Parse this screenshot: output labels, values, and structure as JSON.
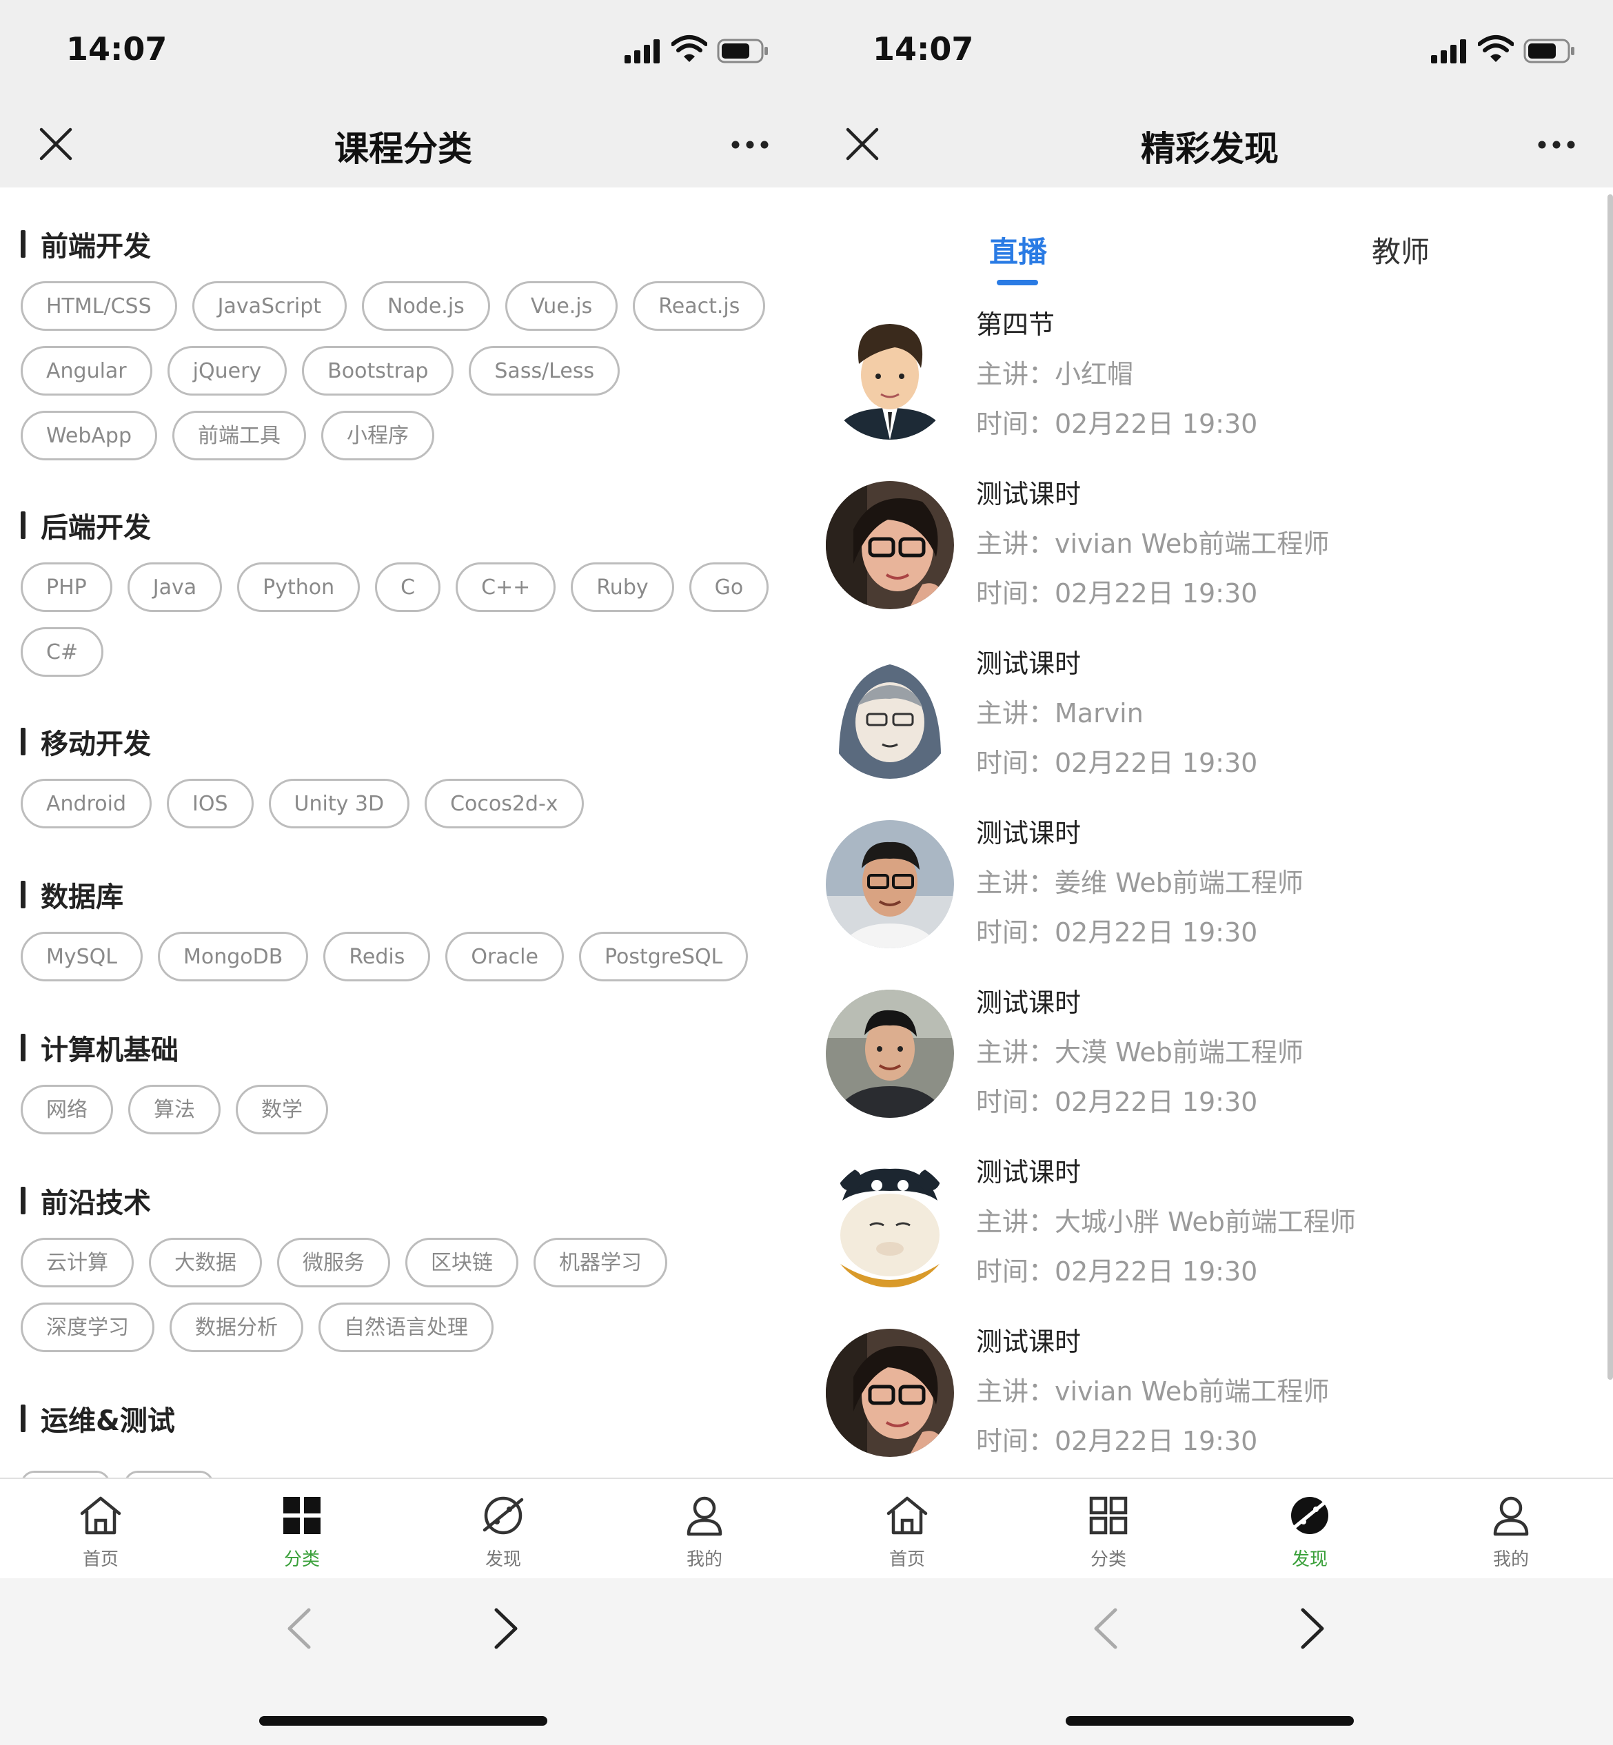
{
  "status": {
    "time": "14:07"
  },
  "left": {
    "title": "课程分类",
    "sections": [
      {
        "title": "前端开发",
        "tags": [
          "HTML/CSS",
          "JavaScript",
          "Node.js",
          "Vue.js",
          "React.js",
          "Angular",
          "jQuery",
          "Bootstrap",
          "Sass/Less",
          "WebApp",
          "前端工具",
          "小程序"
        ]
      },
      {
        "title": "后端开发",
        "tags": [
          "PHP",
          "Java",
          "Python",
          "C",
          "C++",
          "Ruby",
          "Go",
          "C#"
        ]
      },
      {
        "title": "移动开发",
        "tags": [
          "Android",
          "IOS",
          "Unity 3D",
          "Cocos2d-x"
        ]
      },
      {
        "title": "数据库",
        "tags": [
          "MySQL",
          "MongoDB",
          "Redis",
          "Oracle",
          "PostgreSQL"
        ]
      },
      {
        "title": "计算机基础",
        "tags": [
          "网络",
          "算法",
          "数学"
        ]
      },
      {
        "title": "前沿技术",
        "tags": [
          "云计算",
          "大数据",
          "微服务",
          "区块链",
          "机器学习",
          "深度学习",
          "数据分析",
          "自然语言处理"
        ]
      },
      {
        "title": "运维&测试",
        "tags": []
      }
    ]
  },
  "right": {
    "title": "精彩发现",
    "tabs": {
      "live": "直播",
      "teacher": "教师"
    },
    "items": [
      {
        "title": "第四节",
        "host": "主讲：小红帽",
        "time": "时间：02月22日 19:30",
        "avatar": "cartoon-man"
      },
      {
        "title": "测试课时",
        "host": "主讲：vivian  Web前端工程师",
        "time": "时间：02月22日 19:30",
        "avatar": "woman-glasses"
      },
      {
        "title": "测试课时",
        "host": "主讲：Marvin",
        "time": "时间：02月22日 19:30",
        "avatar": "hooded-cartoon"
      },
      {
        "title": "测试课时",
        "host": "主讲：姜维  Web前端工程师",
        "time": "时间：02月22日 19:30",
        "avatar": "man-glasses"
      },
      {
        "title": "测试课时",
        "host": "主讲：大漠  Web前端工程师",
        "time": "时间：02月22日 19:30",
        "avatar": "man-outdoor"
      },
      {
        "title": "测试课时",
        "host": "主讲：大城小胖  Web前端工程师",
        "time": "时间：02月22日 19:30",
        "avatar": "panda-cartoon"
      },
      {
        "title": "测试课时",
        "host": "主讲：vivian  Web前端工程师",
        "time": "时间：02月22日 19:30",
        "avatar": "woman-glasses"
      }
    ]
  },
  "tabbar": {
    "home": "首页",
    "category": "分类",
    "discover": "发现",
    "mine": "我的"
  },
  "colors": {
    "accent": "#2a7be4",
    "active_tab": "#3aa03a",
    "tag_border": "#bdbdbd",
    "tag_text": "#8a8a8a"
  }
}
